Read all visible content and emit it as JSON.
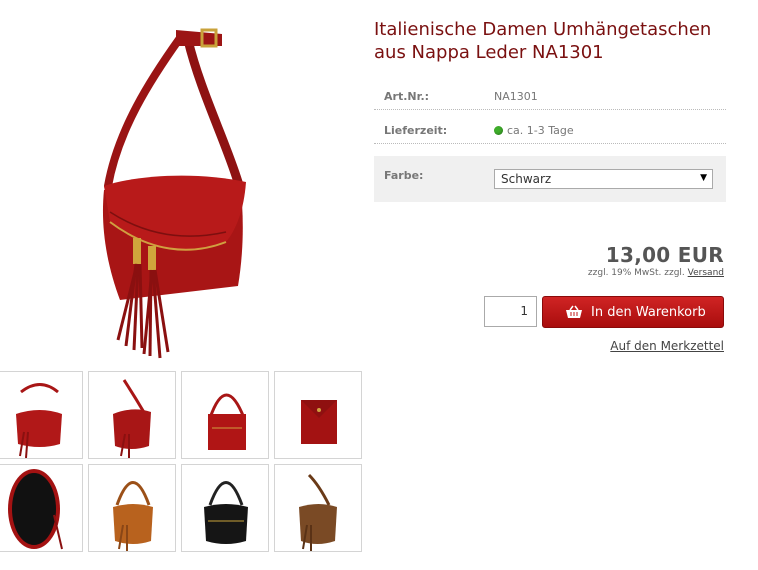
{
  "product": {
    "title_line1": "Italienische Damen Umhängetaschen",
    "title_line2": "aus Nappa Leder NA1301",
    "image_alt": "red-shoulder-bag-with-tassels"
  },
  "details": {
    "art_label": "Art.Nr.:",
    "art_value": "NA1301",
    "delivery_label": "Lieferzeit:",
    "delivery_value": "ca. 1-3 Tage",
    "delivery_status_color": "#3fae2b"
  },
  "options": {
    "color_label": "Farbe:",
    "color_selected": "Schwarz",
    "arrow": "▼"
  },
  "pricing": {
    "price": "13,00 EUR",
    "tax_text": "zzgl. 19% MwSt. zzgl.",
    "shipping_link": "Versand"
  },
  "cart": {
    "quantity": "1",
    "add_to_cart_label": "In den Warenkorb",
    "wishlist_label": "Auf den Merkzettel"
  },
  "colors": {
    "title": "#7a1010",
    "button": "#c01818"
  },
  "thumbnails": [
    {
      "color": "red",
      "hex": "#b11818"
    },
    {
      "color": "red",
      "hex": "#a81616"
    },
    {
      "color": "red",
      "hex": "#b01515"
    },
    {
      "color": "red",
      "hex": "#a31212"
    },
    {
      "color": "black-interior",
      "hex": "#111111"
    },
    {
      "color": "cognac",
      "hex": "#b8621e"
    },
    {
      "color": "black",
      "hex": "#151515"
    },
    {
      "color": "brown",
      "hex": "#7a4a25"
    }
  ]
}
